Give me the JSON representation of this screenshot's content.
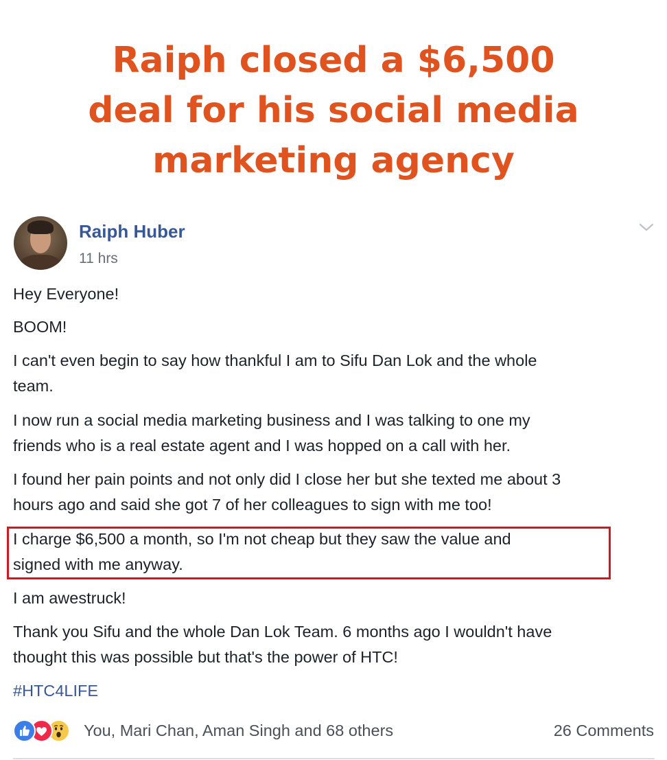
{
  "headline": {
    "lines": [
      "Raiph closed a $6,500",
      "deal for his social media",
      "marketing agency"
    ]
  },
  "post": {
    "author": "Raiph Huber",
    "time": "11 hrs",
    "menu_icon": "chevron-down-icon",
    "paragraphs": [
      [
        "Hey Everyone!"
      ],
      [
        "BOOM!"
      ],
      [
        "I can't even begin to say how thankful I am to Sifu Dan Lok and the whole",
        "team."
      ],
      [
        "I now run a social media marketing business and I was talking to one my",
        "friends who is a real estate agent and I was hopped on a call with her."
      ],
      [
        "I found her pain points and not only did I close her but she texted me about 3",
        "hours ago and said she got 7 of her colleagues to sign with me too!"
      ],
      [
        "I charge $6,500 a month, so I'm not cheap but they saw the value and",
        "signed with me anyway."
      ],
      [
        "I am awestruck!"
      ],
      [
        "Thank you Sifu and the whole Dan Lok Team. 6 months ago I wouldn't have",
        "thought this was possible but that's the power of HTC!"
      ]
    ],
    "hashtag": "#HTC4LIFE",
    "highlight_color": "#d9141a",
    "reactions": {
      "icons": [
        "like-icon",
        "love-icon",
        "wow-icon"
      ],
      "text": "You, Mari Chan, Aman Singh and 68 others"
    },
    "comments": "26 Comments"
  },
  "colors": {
    "headline": "#e0531f",
    "author_link": "#365899",
    "body_text": "#1d2129",
    "meta_text": "#6a6e75"
  }
}
